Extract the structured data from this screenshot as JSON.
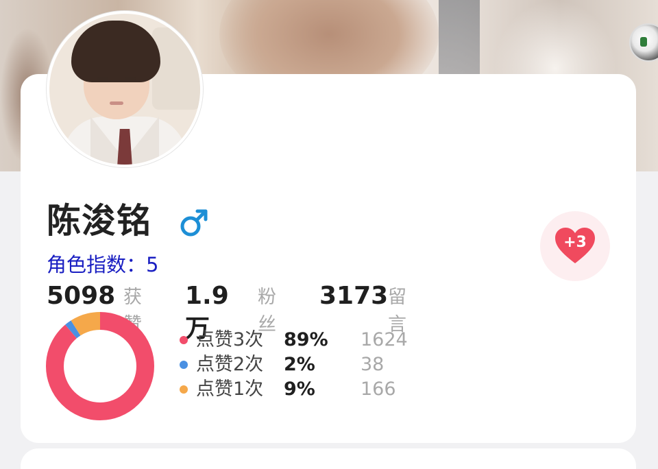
{
  "profile": {
    "name": "陈浚铭",
    "gender_symbol": "♂",
    "gender": "male",
    "role_index": "角色指数：5"
  },
  "stats": [
    {
      "value": "5098",
      "label": "获赞"
    },
    {
      "value": "1.9万",
      "label": "粉丝"
    },
    {
      "value": "3173",
      "label": "留言"
    }
  ],
  "like_button": {
    "label": "+3"
  },
  "chart_data": {
    "type": "pie",
    "style": "donut",
    "categories": [
      "点赞3次",
      "点赞2次",
      "点赞1次"
    ],
    "percent_labels": [
      "89%",
      "2%",
      "9%"
    ],
    "values": [
      1624,
      38,
      166
    ],
    "counts_text": [
      "1624",
      "38",
      "166"
    ],
    "colors": [
      "#f24d6b",
      "#4a90e2",
      "#f5a84a"
    ]
  },
  "colors": {
    "accent_pink": "#f24d6b",
    "index_blue": "#1a1fc2",
    "gender_blue": "#1d8fd6"
  }
}
